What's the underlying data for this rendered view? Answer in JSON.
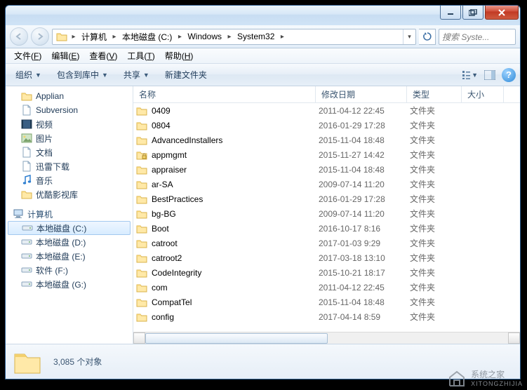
{
  "breadcrumb": {
    "parts": [
      "计算机",
      "本地磁盘 (C:)",
      "Windows",
      "System32"
    ]
  },
  "search": {
    "placeholder": "搜索 Syste..."
  },
  "menubar": {
    "items": [
      {
        "label": "文件",
        "accel": "F"
      },
      {
        "label": "编辑",
        "accel": "E"
      },
      {
        "label": "查看",
        "accel": "V"
      },
      {
        "label": "工具",
        "accel": "T"
      },
      {
        "label": "帮助",
        "accel": "H"
      }
    ]
  },
  "toolbar": {
    "organize": "组织",
    "include": "包含到库中",
    "share": "共享",
    "newfolder": "新建文件夹"
  },
  "columns": {
    "name": "名称",
    "date": "修改日期",
    "type": "类型",
    "size": "大小"
  },
  "sidebar": {
    "top": [
      {
        "label": "Applian",
        "icon": "folder"
      },
      {
        "label": "Subversion",
        "icon": "doc"
      },
      {
        "label": "视频",
        "icon": "video"
      },
      {
        "label": "图片",
        "icon": "picture"
      },
      {
        "label": "文档",
        "icon": "doc"
      },
      {
        "label": "迅雷下载",
        "icon": "doc"
      },
      {
        "label": "音乐",
        "icon": "music"
      },
      {
        "label": "优酷影视库",
        "icon": "folder"
      }
    ],
    "computer_header": "计算机",
    "drives": [
      {
        "label": "本地磁盘 (C:)",
        "sel": true
      },
      {
        "label": "本地磁盘 (D:)",
        "sel": false
      },
      {
        "label": "本地磁盘 (E:)",
        "sel": false
      },
      {
        "label": "软件 (F:)",
        "sel": false
      },
      {
        "label": "本地磁盘 (G:)",
        "sel": false
      }
    ]
  },
  "files": [
    {
      "name": "0409",
      "date": "2011-04-12 22:45",
      "type": "文件夹",
      "icon": "folder"
    },
    {
      "name": "0804",
      "date": "2016-01-29 17:28",
      "type": "文件夹",
      "icon": "folder"
    },
    {
      "name": "AdvancedInstallers",
      "date": "2015-11-04 18:48",
      "type": "文件夹",
      "icon": "folder"
    },
    {
      "name": "appmgmt",
      "date": "2015-11-27 14:42",
      "type": "文件夹",
      "icon": "folder-lock"
    },
    {
      "name": "appraiser",
      "date": "2015-11-04 18:48",
      "type": "文件夹",
      "icon": "folder"
    },
    {
      "name": "ar-SA",
      "date": "2009-07-14 11:20",
      "type": "文件夹",
      "icon": "folder"
    },
    {
      "name": "BestPractices",
      "date": "2016-01-29 17:28",
      "type": "文件夹",
      "icon": "folder"
    },
    {
      "name": "bg-BG",
      "date": "2009-07-14 11:20",
      "type": "文件夹",
      "icon": "folder"
    },
    {
      "name": "Boot",
      "date": "2016-10-17 8:16",
      "type": "文件夹",
      "icon": "folder"
    },
    {
      "name": "catroot",
      "date": "2017-01-03 9:29",
      "type": "文件夹",
      "icon": "folder"
    },
    {
      "name": "catroot2",
      "date": "2017-03-18 13:10",
      "type": "文件夹",
      "icon": "folder"
    },
    {
      "name": "CodeIntegrity",
      "date": "2015-10-21 18:17",
      "type": "文件夹",
      "icon": "folder"
    },
    {
      "name": "com",
      "date": "2011-04-12 22:45",
      "type": "文件夹",
      "icon": "folder"
    },
    {
      "name": "CompatTel",
      "date": "2015-11-04 18:48",
      "type": "文件夹",
      "icon": "folder"
    },
    {
      "name": "config",
      "date": "2017-04-14 8:59",
      "type": "文件夹",
      "icon": "folder"
    }
  ],
  "status": {
    "count": "3,085 个对象"
  },
  "branding": {
    "name": "系统之家",
    "sub": "XITONGZHIJIA"
  }
}
